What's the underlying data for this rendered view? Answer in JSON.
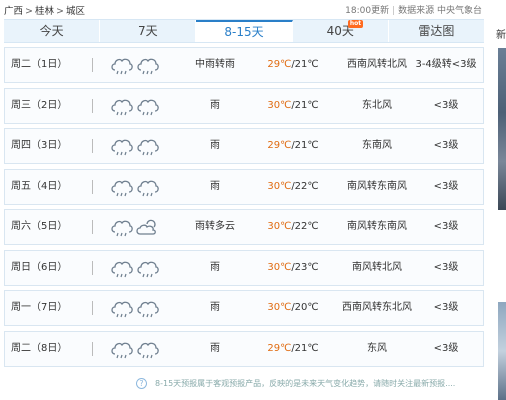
{
  "breadcrumb": [
    "广西",
    "桂林",
    "城区"
  ],
  "update": {
    "time": "18:00更新",
    "source": "数据来源 中央气象台"
  },
  "tabs": [
    {
      "label": "今天",
      "active": false,
      "hot": false
    },
    {
      "label": "7天",
      "active": false,
      "hot": false
    },
    {
      "label": "8-15天",
      "active": true,
      "hot": false
    },
    {
      "label": "40天",
      "active": false,
      "hot": true
    },
    {
      "label": "雷达图",
      "active": false,
      "hot": false
    }
  ],
  "hot_badge": "hot",
  "rows": [
    {
      "day": "周二（1日）",
      "desc": "中雨转雨",
      "high": "29℃",
      "low": "/21℃",
      "wind": "西南风转北风",
      "level": "3-4级转<3级",
      "icons": [
        "rain-icon",
        "rain-icon"
      ]
    },
    {
      "day": "周三（2日）",
      "desc": "雨",
      "high": "30℃",
      "low": "/21℃",
      "wind": "东北风",
      "level": "<3级",
      "icons": [
        "rain-icon",
        "rain-icon"
      ]
    },
    {
      "day": "周四（3日）",
      "desc": "雨",
      "high": "29℃",
      "low": "/21℃",
      "wind": "东南风",
      "level": "<3级",
      "icons": [
        "rain-icon",
        "rain-icon"
      ]
    },
    {
      "day": "周五（4日）",
      "desc": "雨",
      "high": "30℃",
      "low": "/22℃",
      "wind": "南风转东南风",
      "level": "<3级",
      "icons": [
        "rain-icon",
        "rain-icon"
      ]
    },
    {
      "day": "周六（5日）",
      "desc": "雨转多云",
      "high": "30℃",
      "low": "/22℃",
      "wind": "南风转东南风",
      "level": "<3级",
      "icons": [
        "rain-icon",
        "partly-cloudy-icon"
      ]
    },
    {
      "day": "周日（6日）",
      "desc": "雨",
      "high": "30℃",
      "low": "/23℃",
      "wind": "南风转北风",
      "level": "<3级",
      "icons": [
        "rain-icon",
        "rain-icon"
      ]
    },
    {
      "day": "周一（7日）",
      "desc": "雨",
      "high": "30℃",
      "low": "/20℃",
      "wind": "西南风转东北风",
      "level": "<3级",
      "icons": [
        "rain-icon",
        "rain-icon"
      ]
    },
    {
      "day": "周二（8日）",
      "desc": "雨",
      "high": "29℃",
      "low": "/21℃",
      "wind": "东风",
      "level": "<3级",
      "icons": [
        "rain-icon",
        "rain-icon"
      ]
    }
  ],
  "footnote": "8-15天预报属于客观预报产品，反映的是未来天气变化趋势，请随时关注最新预报....",
  "footnote_icon": "?",
  "side_heading": "新",
  "colors": {
    "accent": "#2a7fc8",
    "high_temp": "#e06c12",
    "tab_bg": "#e9f3fb",
    "hot": "#ff6a1f"
  }
}
